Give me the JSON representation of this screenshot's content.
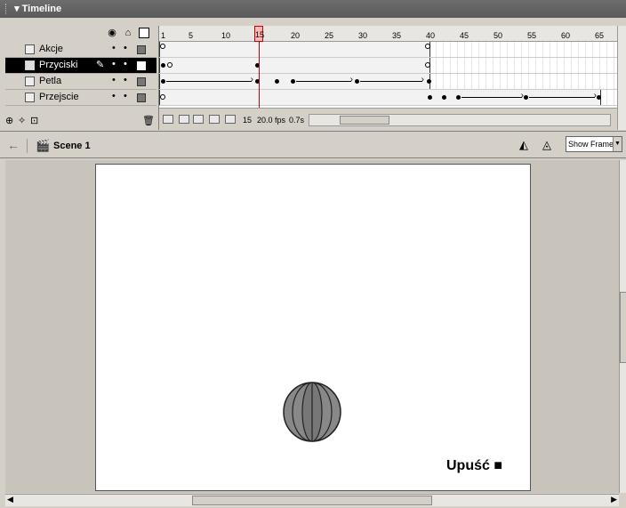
{
  "timeline": {
    "title": "Timeline",
    "icons": {
      "eye": "eye-icon",
      "lock": "lock-icon",
      "outline": "outline-icon"
    },
    "layers": [
      {
        "name": "Akcje",
        "active": false,
        "dot1": "•",
        "dot2": "•"
      },
      {
        "name": "Przyciski",
        "active": true,
        "dot1": "•",
        "dot2": "•"
      },
      {
        "name": "Petla",
        "active": false,
        "dot1": "•",
        "dot2": "•"
      },
      {
        "name": "Przejscie",
        "active": false,
        "dot1": "•",
        "dot2": "•"
      }
    ],
    "ruler_ticks": [
      "1",
      "5",
      "10",
      "15",
      "20",
      "25",
      "30",
      "35",
      "40",
      "45",
      "50",
      "55",
      "60",
      "65"
    ],
    "playhead_frame": "15",
    "status": {
      "current_frame": "15",
      "fps": "20.0 fps",
      "time": "0.7s"
    }
  },
  "scene": {
    "name": "Scene 1",
    "zoom": "Show Frame"
  },
  "stage": {
    "label": "Upuść ■"
  }
}
